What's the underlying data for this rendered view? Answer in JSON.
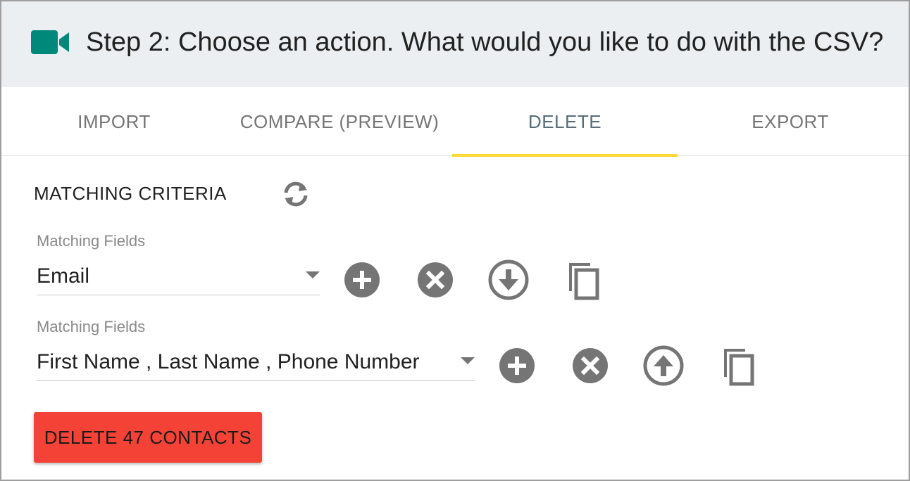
{
  "header": {
    "title": "Step 2: Choose an action. What would you like to do with the CSV?",
    "icon": "video-camera-icon",
    "icon_color": "#00897b"
  },
  "tabs": [
    {
      "label": "IMPORT",
      "active": false
    },
    {
      "label": "COMPARE (PREVIEW)",
      "active": false
    },
    {
      "label": "DELETE",
      "active": true
    },
    {
      "label": "EXPORT",
      "active": false
    }
  ],
  "colors": {
    "tab_indicator": "#fdd835",
    "delete_button": "#f44336",
    "icon_gray": "#757575"
  },
  "section": {
    "title": "MATCHING CRITERIA",
    "refresh_icon": "refresh-icon"
  },
  "criteria": [
    {
      "label": "Matching Fields",
      "value": "Email",
      "actions": [
        "add-circle-icon",
        "cancel-circle-icon",
        "arrow-down-circle-icon",
        "copy-icon"
      ]
    },
    {
      "label": "Matching Fields",
      "value": "First Name , Last Name , Phone Number",
      "actions": [
        "add-circle-icon",
        "cancel-circle-icon",
        "arrow-up-circle-icon",
        "copy-icon"
      ]
    }
  ],
  "delete_button": {
    "label": "DELETE 47 CONTACTS"
  }
}
